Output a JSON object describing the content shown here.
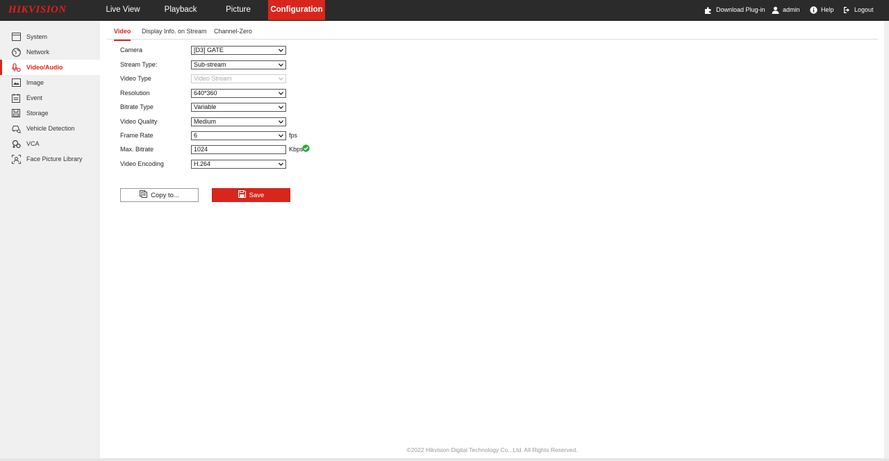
{
  "brand": "HIKVISION",
  "nav": {
    "items": [
      {
        "label": "Live View"
      },
      {
        "label": "Playback"
      },
      {
        "label": "Picture"
      },
      {
        "label": "Configuration"
      }
    ],
    "active": "Configuration"
  },
  "top_right": {
    "download": "Download Plug-in",
    "user": "admin",
    "help": "Help",
    "logout": "Logout"
  },
  "sidebar": {
    "items": [
      {
        "label": "System",
        "icon": "system-icon"
      },
      {
        "label": "Network",
        "icon": "network-icon"
      },
      {
        "label": "Video/Audio",
        "icon": "video-audio-icon"
      },
      {
        "label": "Image",
        "icon": "image-icon"
      },
      {
        "label": "Event",
        "icon": "event-icon"
      },
      {
        "label": "Storage",
        "icon": "storage-icon"
      },
      {
        "label": "Vehicle Detection",
        "icon": "vehicle-detection-icon"
      },
      {
        "label": "VCA",
        "icon": "vca-icon"
      },
      {
        "label": "Face Picture Library",
        "icon": "face-library-icon"
      }
    ],
    "active": "Video/Audio"
  },
  "tabs": [
    {
      "label": "Video"
    },
    {
      "label": "Display Info. on Stream"
    },
    {
      "label": "Channel-Zero"
    }
  ],
  "form": {
    "camera": {
      "label": "Camera",
      "value": "[D3] GATE"
    },
    "stream_type": {
      "label": "Stream Type:",
      "value": "Sub-stream"
    },
    "video_type": {
      "label": "Video Type",
      "value": "Video Stream",
      "disabled": true
    },
    "resolution": {
      "label": "Resolution",
      "value": "640*360"
    },
    "bitrate_type": {
      "label": "Bitrate Type",
      "value": "Variable"
    },
    "video_quality": {
      "label": "Video Quality",
      "value": "Medium"
    },
    "frame_rate": {
      "label": "Frame Rate",
      "value": "6",
      "unit": "fps"
    },
    "max_bitrate": {
      "label": "Max. Bitrate",
      "value": "1024",
      "unit": "Kbps"
    },
    "video_encoding": {
      "label": "Video Encoding",
      "value": "H.264"
    }
  },
  "buttons": {
    "copy": "Copy to...",
    "save": "Save"
  },
  "footer": "©2022 Hikvision Digital Technology Co., Ltd. All Rights Reserved.",
  "colors": {
    "accent": "#d9261c",
    "topbar": "#2b2b2b",
    "valid": "#2eaa3c"
  }
}
